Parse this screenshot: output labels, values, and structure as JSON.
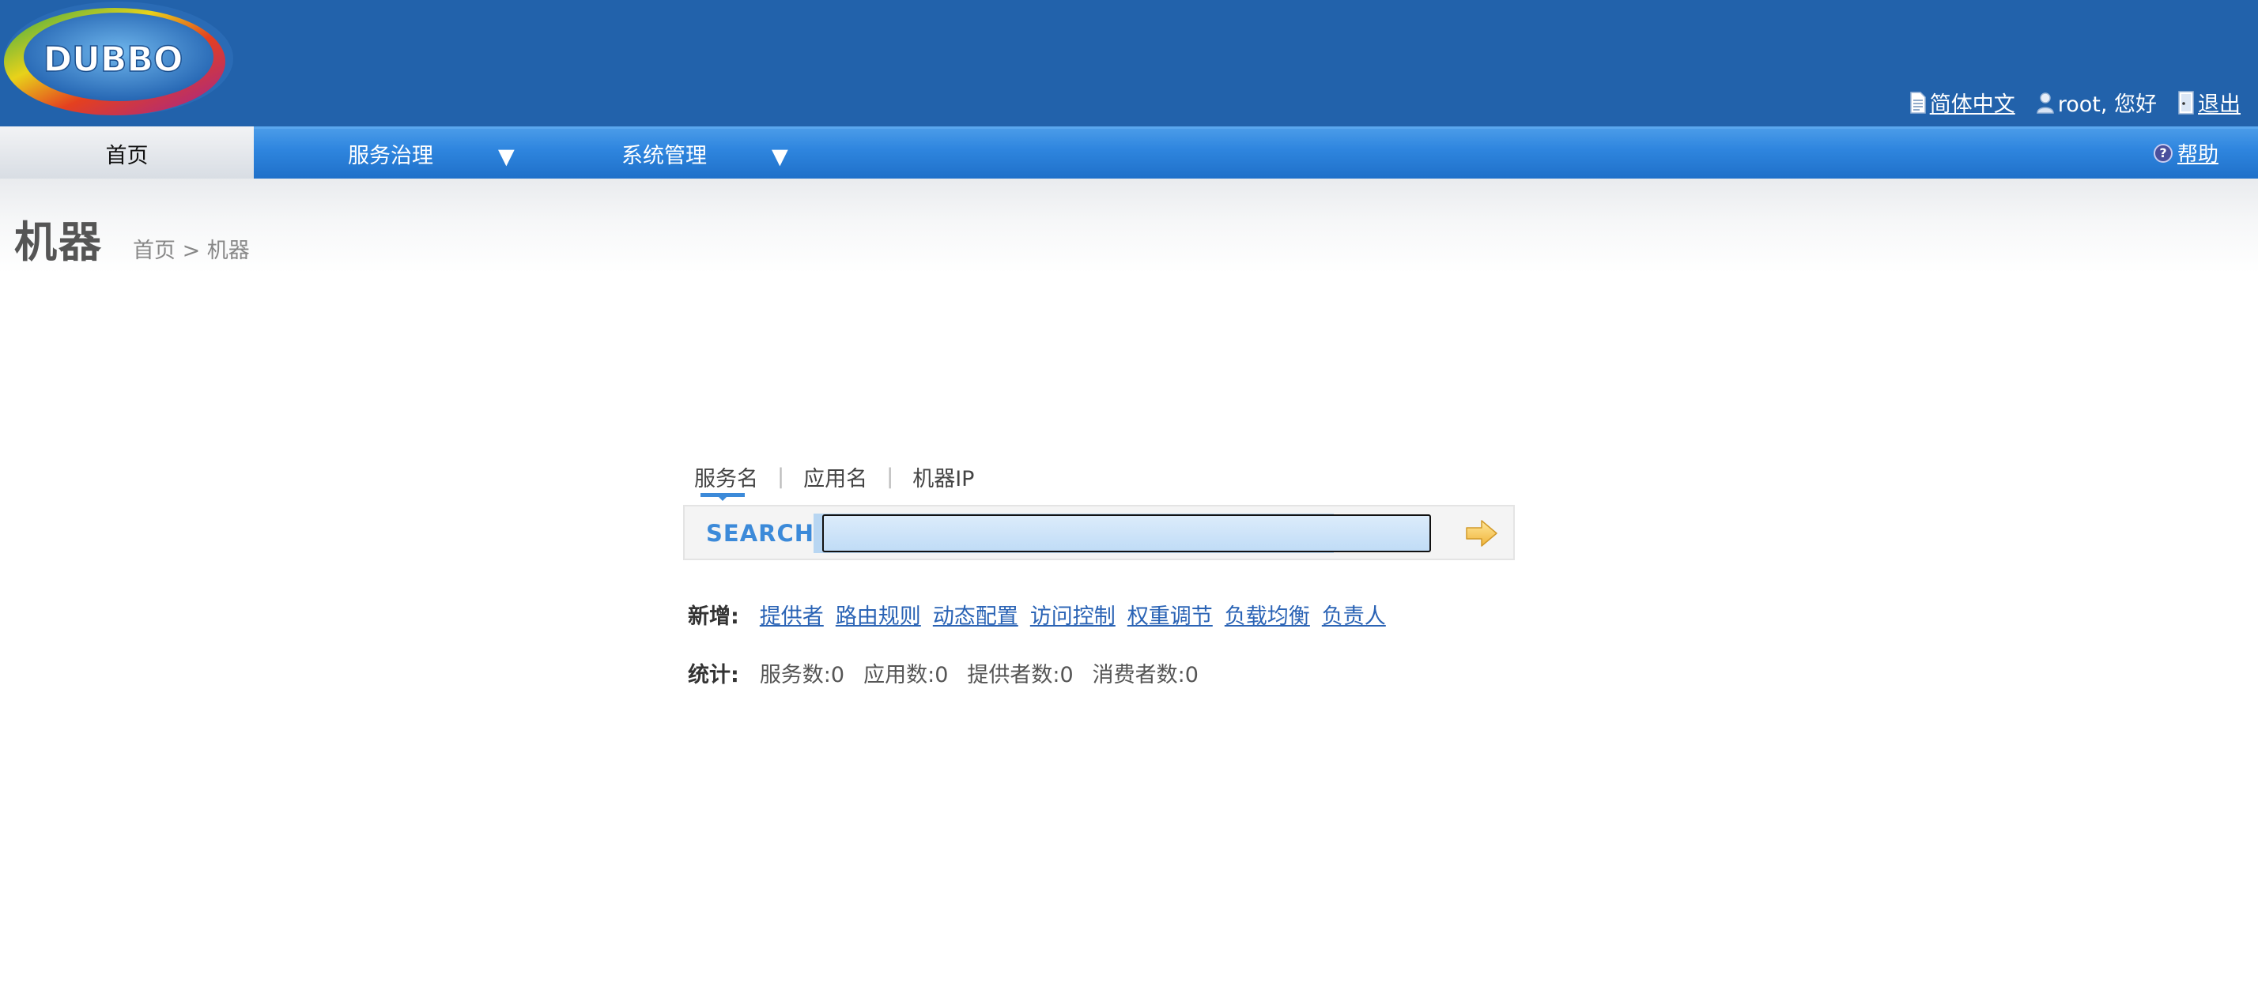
{
  "header": {
    "logo_text": "DUBBO",
    "language_label": "简体中文",
    "user_greeting": "root, 您好",
    "logout_label": "退出"
  },
  "nav": {
    "home_label": "首页",
    "items": [
      {
        "label": "服务治理"
      },
      {
        "label": "系统管理"
      }
    ],
    "help_label": "帮助"
  },
  "page": {
    "title": "机器",
    "breadcrumb": "首页 > 机器"
  },
  "search": {
    "tabs": [
      "服务名",
      "应用名",
      "机器IP"
    ],
    "active_tab": "服务名",
    "label": "SEARCH",
    "value": "",
    "placeholder": ""
  },
  "create": {
    "label": "新增:",
    "links": [
      "提供者",
      "路由规则",
      "动态配置",
      "访问控制",
      "权重调节",
      "负载均衡",
      "负责人"
    ]
  },
  "stats": {
    "label": "统计:",
    "items": [
      "服务数:0",
      "应用数:0",
      "提供者数:0",
      "消费者数:0"
    ]
  },
  "colors": {
    "header_bg": "#2262ab",
    "nav_bg": "#2f86df",
    "link": "#2a63b5",
    "search_accent": "#3c8ad9"
  }
}
